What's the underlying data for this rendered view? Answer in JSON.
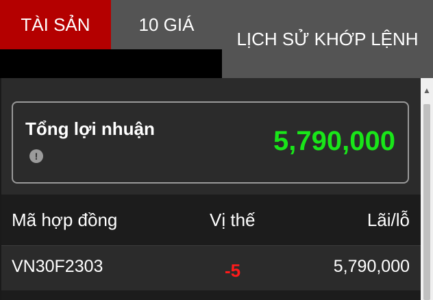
{
  "tabs": [
    {
      "label": "TÀI SẢN",
      "active": true
    },
    {
      "label": "10 GIÁ",
      "active": false
    },
    {
      "label": "LỊCH SỬ KHỚP LỆNH",
      "active": false
    }
  ],
  "summary": {
    "label": "Tổng lợi nhuận",
    "info_icon_glyph": "!",
    "value": "5,790,000",
    "value_color": "#19e619"
  },
  "table": {
    "headers": [
      "Mã hợp đồng",
      "Vị thế",
      "Lãi/lỗ"
    ],
    "rows": [
      {
        "code": "VN30F2303",
        "position": "-5",
        "pnl": "5,790,000"
      }
    ]
  },
  "colors": {
    "active_tab": "#b40000",
    "negative": "#ff1a1a",
    "positive": "#19e619"
  },
  "icons": [
    "info-icon",
    "scroll-up-arrow-icon"
  ]
}
